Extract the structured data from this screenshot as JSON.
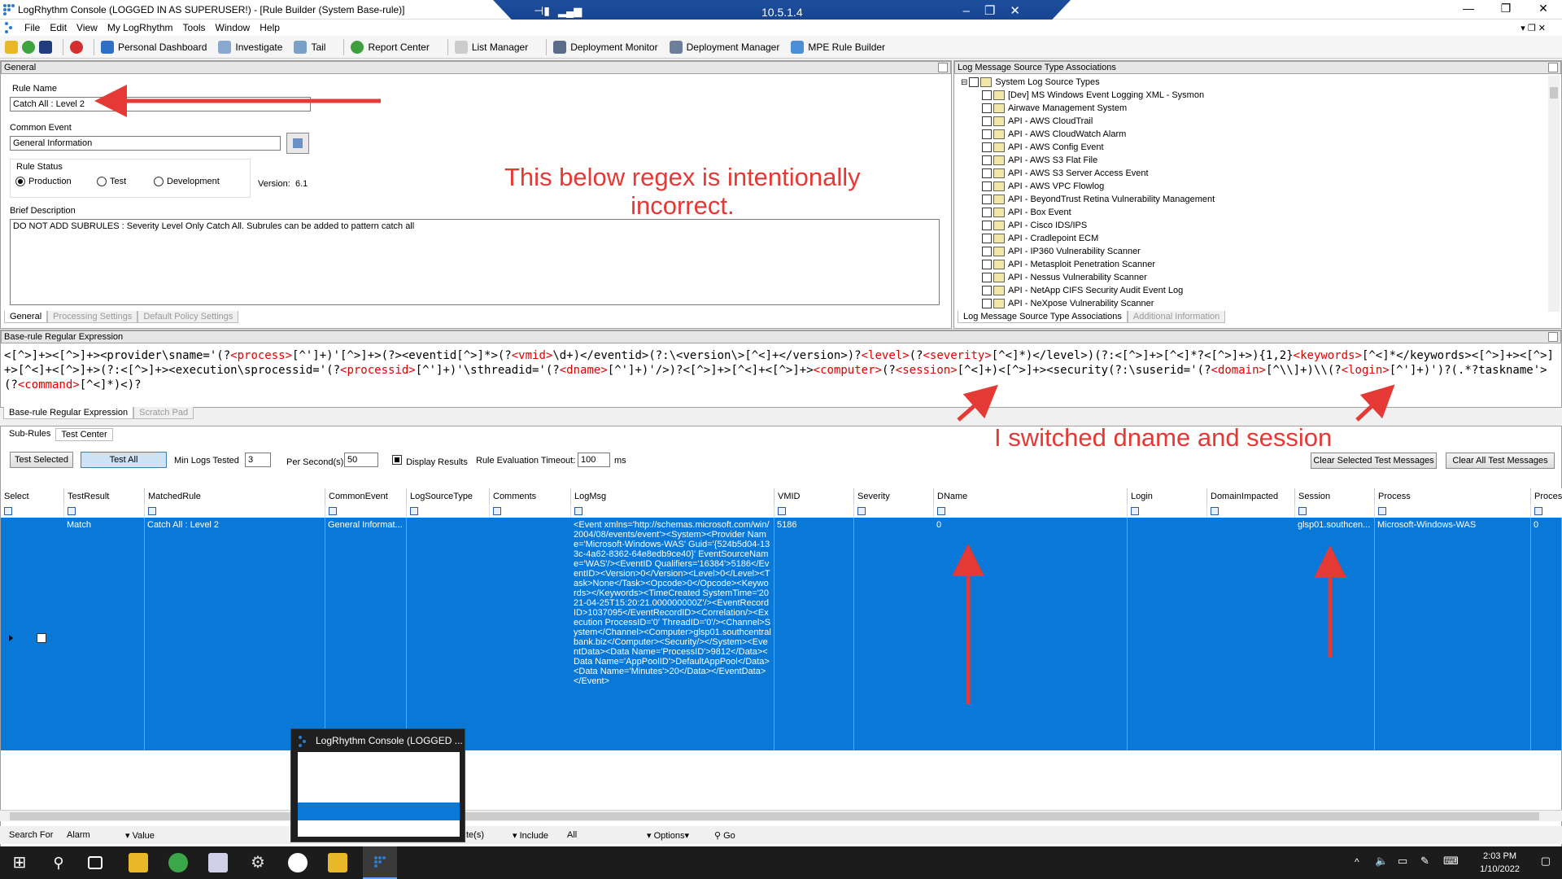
{
  "window": {
    "title": "LogRhythm Console  (LOGGED IN AS SUPERUSER!) - [Rule Builder (System Base-rule)]",
    "rdp_ip": "10.5.1.4"
  },
  "menu": [
    "File",
    "Edit",
    "View",
    "My LogRhythm",
    "Tools",
    "Window",
    "Help"
  ],
  "toolbar": [
    "Personal Dashboard",
    "Investigate",
    "Tail",
    "Report Center",
    "List Manager",
    "Deployment Monitor",
    "Deployment Manager",
    "MPE Rule Builder"
  ],
  "general": {
    "header": "General",
    "rule_name_label": "Rule Name",
    "rule_name": "Catch All : Level 2",
    "common_event_label": "Common Event",
    "common_event": "General Information",
    "rule_status_label": "Rule Status",
    "statuses": [
      "Production",
      "Test",
      "Development"
    ],
    "version_label": "Version:",
    "version": "6.1",
    "brief_label": "Brief Description",
    "brief": "DO NOT ADD SUBRULES : Severity Level Only Catch All. Subrules can be added to pattern catch all",
    "tabs": [
      "General",
      "Processing Settings",
      "Default Policy Settings"
    ]
  },
  "log_sources": {
    "header": "Log Message Source Type Associations",
    "root": "System Log Source Types",
    "items": [
      "[Dev] MS Windows Event Logging XML - Sysmon",
      "Airwave Management System",
      "API - AWS CloudTrail",
      "API - AWS CloudWatch Alarm",
      "API - AWS Config Event",
      "API - AWS S3 Flat File",
      "API - AWS S3 Server Access Event",
      "API - AWS VPC Flowlog",
      "API - BeyondTrust Retina Vulnerability Management",
      "API - Box Event",
      "API - Cisco IDS/IPS",
      "API - Cradlepoint ECM",
      "API - IP360 Vulnerability Scanner",
      "API - Metasploit Penetration Scanner",
      "API - Nessus Vulnerability Scanner",
      "API - NetApp CIFS Security Audit Event Log",
      "API - NeXpose Vulnerability Scanner"
    ],
    "tabs": [
      "Log Message Source Type Associations",
      "Additional Information"
    ]
  },
  "regex": {
    "header": "Base-rule Regular Expression",
    "parts": [
      [
        "<[^>]+><[^>]+><provider\\sname='(?",
        0
      ],
      [
        "<process>",
        1
      ],
      [
        "[^']+)'[^>]+>(?><eventid[^>]*>(?",
        0
      ],
      [
        "<vmid>",
        1
      ],
      [
        "\\d+)</eventid>(?:\\<version\\>[^<]+</version>)?",
        0
      ],
      [
        "<level>",
        1
      ],
      [
        "(?",
        0
      ],
      [
        "<severity>",
        1
      ],
      [
        "[^<]*)</level>)(?:<[^>]+>[^<]*?<[^>]+>){1,2}",
        0
      ],
      [
        "<keywords>",
        1
      ],
      [
        "[^<]*</keywords><[^>]+><[^>]+>[^<]+<[^>]+>(?:<[^>]+><execution\\sprocessid='(?",
        0
      ],
      [
        "<processid>",
        1
      ],
      [
        "[^']+)'\\sthreadid='(?",
        0
      ],
      [
        "<dname>",
        1
      ],
      [
        "[^']+)'/>)?<[^>]+>[^<]+<[^>]+>",
        0
      ],
      [
        "<computer>",
        1
      ],
      [
        "(?",
        0
      ],
      [
        "<session>",
        1
      ],
      [
        "[^<]+)<[^>]+><security(?:\\suserid='(?",
        0
      ],
      [
        "<domain>",
        1
      ],
      [
        "[^\\\\]+)\\\\(?",
        0
      ],
      [
        "<login>",
        1
      ],
      [
        "[^']+)')?(.*?taskname'>(?",
        0
      ],
      [
        "<command>",
        1
      ],
      [
        "[^<]*)<)?",
        0
      ]
    ],
    "tabs": [
      "Base-rule Regular Expression",
      "Scratch Pad"
    ]
  },
  "annotations": {
    "top_line1": "This below regex is intentionally",
    "top_line2": "incorrect.",
    "bottom": "I switched dname and session"
  },
  "test_center": {
    "tabs": [
      "Sub-Rules",
      "Test Center"
    ],
    "btn_test_selected": "Test Selected",
    "btn_test_all": "Test All",
    "min_logs_label": "Min Logs Tested",
    "min_logs": "3",
    "per_second_label": "Per Second(s)",
    "per_second": "50",
    "display_results": "Display Results",
    "timeout_label": "Rule Evaluation Timeout:",
    "timeout": "100",
    "timeout_unit": "ms",
    "btn_clear_selected": "Clear Selected Test Messages",
    "btn_clear_all": "Clear All Test Messages",
    "columns": [
      "Select",
      "TestResult",
      "MatchedRule",
      "CommonEvent",
      "LogSourceType",
      "Comments",
      "LogMsg",
      "VMID",
      "Severity",
      "DName",
      "Login",
      "DomainImpacted",
      "Session",
      "Process",
      "Proces"
    ],
    "row": {
      "result": "Match",
      "rule": "Catch All : Level 2",
      "event": "General Informat...",
      "logmsg": "<Event xmlns='http://schemas.microsoft.com/win/2004/08/events/event'><System><Provider Name='Microsoft-Windows-WAS' Guid='{524b5d04-133c-4a62-8362-64e8edb9ce40}' EventSourceName='WAS'/><EventID Qualifiers='16384'>5186</EventID><Version>0</Version><Level>0</Level><Task>None</Task><Opcode>0</Opcode><Keywords></Keywords><TimeCreated SystemTime='2021-04-25T15:20:21.000000000Z'/><EventRecordID>1037095</EventRecordID><Correlation/><Execution ProcessID='0' ThreadID='0'/><Channel>System</Channel><Computer>glsp01.southcentralbank.biz</Computer><Security/></System><EventData><Data Name='ProcessID'>9812</Data><Data Name='AppPoolID'>DefaultAppPool</Data><Data Name='Minutes'>20</Data></EventData></Event>",
      "vmid": "5186",
      "dname": "0",
      "session": "glsp01.southcen...",
      "process": "Microsoft-Windows-WAS",
      "proces2": "0"
    }
  },
  "thumbnail_title": "LogRhythm Console (LOGGED ...",
  "searchbar": {
    "search_for": "Search For",
    "alarm": "Alarm",
    "value": "Value",
    "te": "te(s)",
    "include": "Include",
    "all": "All",
    "options": "Options",
    "go": "Go"
  },
  "clock": {
    "time": "2:03 PM",
    "date": "1/10/2022"
  }
}
